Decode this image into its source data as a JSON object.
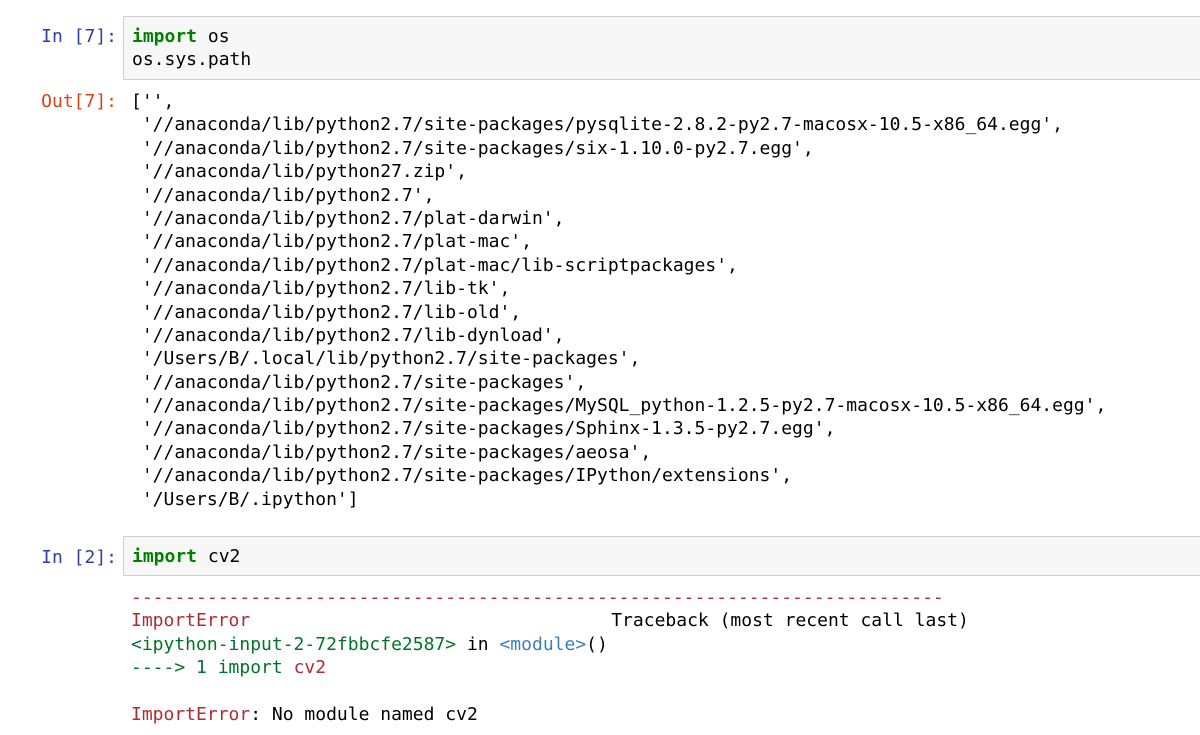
{
  "cells": [
    {
      "in_prompt": "In [7]:",
      "code_lines": [
        {
          "kw": "import",
          "rest": " os"
        },
        {
          "kw": "",
          "rest": "os.sys.path"
        }
      ],
      "out_prompt": "Out[7]:",
      "output_lines": [
        "['',",
        " '//anaconda/lib/python2.7/site-packages/pysqlite-2.8.2-py2.7-macosx-10.5-x86_64.egg',",
        " '//anaconda/lib/python2.7/site-packages/six-1.10.0-py2.7.egg',",
        " '//anaconda/lib/python27.zip',",
        " '//anaconda/lib/python2.7',",
        " '//anaconda/lib/python2.7/plat-darwin',",
        " '//anaconda/lib/python2.7/plat-mac',",
        " '//anaconda/lib/python2.7/plat-mac/lib-scriptpackages',",
        " '//anaconda/lib/python2.7/lib-tk',",
        " '//anaconda/lib/python2.7/lib-old',",
        " '//anaconda/lib/python2.7/lib-dynload',",
        " '/Users/B/.local/lib/python2.7/site-packages',",
        " '//anaconda/lib/python2.7/site-packages',",
        " '//anaconda/lib/python2.7/site-packages/MySQL_python-1.2.5-py2.7-macosx-10.5-x86_64.egg',",
        " '//anaconda/lib/python2.7/site-packages/Sphinx-1.3.5-py2.7.egg',",
        " '//anaconda/lib/python2.7/site-packages/aeosa',",
        " '//anaconda/lib/python2.7/site-packages/IPython/extensions',",
        " '/Users/B/.ipython']"
      ]
    },
    {
      "in_prompt": "In [2]:",
      "code_lines": [
        {
          "kw": "import",
          "rest": " cv2"
        }
      ],
      "traceback": {
        "separator": "---------------------------------------------------------------------------",
        "error_name": "ImportError",
        "traceback_header": "Traceback (most recent call last)",
        "location_file": "<ipython-input-2-72fbbcfe2587>",
        "location_in": " in ",
        "location_module": "<module>",
        "location_parens": "()",
        "arrow": "----> 1 ",
        "arrow_code_kw": "import",
        "arrow_code_rest": " cv2",
        "final_error": "ImportError",
        "final_message": ": No module named cv2"
      }
    }
  ],
  "colors": {
    "in_prompt": "#303F9F",
    "out_prompt": "#D84315",
    "keyword": "#008000",
    "input_bg": "#f7f7f7",
    "input_border": "#cfcfcf",
    "tb_red": "#B22B31",
    "tb_green": "#007427",
    "tb_blue": "#3A7FC0"
  }
}
